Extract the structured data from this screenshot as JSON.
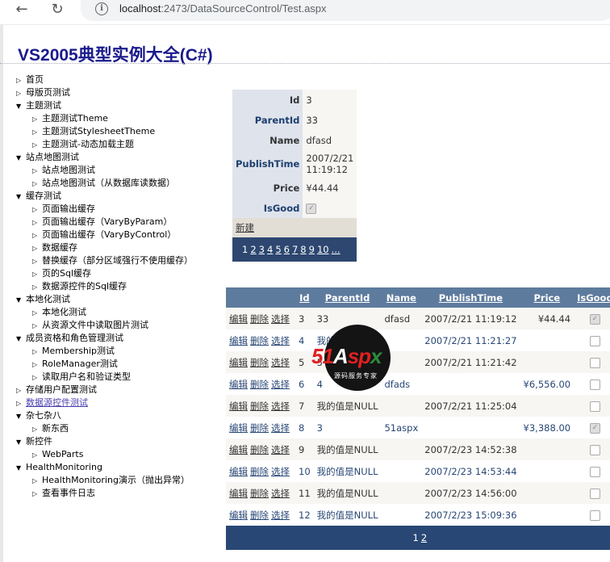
{
  "browser": {
    "url_host": "localhost",
    "url_rest": ":2473/DataSourceControl/Test.aspx"
  },
  "page": {
    "title": "VS2005典型实例大全(C#)"
  },
  "tree": {
    "nodes": [
      {
        "label": "首页",
        "level": 0,
        "state": "collapsed"
      },
      {
        "label": "母版页测试",
        "level": 0,
        "state": "collapsed"
      },
      {
        "label": "主题测试",
        "level": 0,
        "state": "expanded"
      },
      {
        "label": "主题测试Theme",
        "level": 1,
        "state": "collapsed"
      },
      {
        "label": "主题测试StylesheetTheme",
        "level": 1,
        "state": "collapsed"
      },
      {
        "label": "主题测试-动态加载主题",
        "level": 1,
        "state": "collapsed"
      },
      {
        "label": "站点地图测试",
        "level": 0,
        "state": "expanded"
      },
      {
        "label": "站点地图测试",
        "level": 1,
        "state": "collapsed"
      },
      {
        "label": "站点地图测试（从数据库读数据）",
        "level": 1,
        "state": "collapsed"
      },
      {
        "label": "缓存测试",
        "level": 0,
        "state": "expanded"
      },
      {
        "label": "页面输出缓存",
        "level": 1,
        "state": "collapsed"
      },
      {
        "label": "页面输出缓存（VaryByParam）",
        "level": 1,
        "state": "collapsed"
      },
      {
        "label": "页面输出缓存（VaryByControl）",
        "level": 1,
        "state": "collapsed"
      },
      {
        "label": "数据缓存",
        "level": 1,
        "state": "collapsed"
      },
      {
        "label": "替换缓存（部分区域强行不使用缓存）",
        "level": 1,
        "state": "collapsed"
      },
      {
        "label": "页的Sql缓存",
        "level": 1,
        "state": "collapsed"
      },
      {
        "label": "数据源控件的Sql缓存",
        "level": 1,
        "state": "collapsed"
      },
      {
        "label": "本地化测试",
        "level": 0,
        "state": "expanded"
      },
      {
        "label": "本地化测试",
        "level": 1,
        "state": "collapsed"
      },
      {
        "label": "从资源文件中读取图片测试",
        "level": 1,
        "state": "collapsed"
      },
      {
        "label": "成员资格和角色管理测试",
        "level": 0,
        "state": "expanded"
      },
      {
        "label": "Membership测试",
        "level": 1,
        "state": "collapsed"
      },
      {
        "label": "RoleManager测试",
        "level": 1,
        "state": "collapsed"
      },
      {
        "label": "读取用户名和验证类型",
        "level": 1,
        "state": "collapsed"
      },
      {
        "label": "存储用户配置测试",
        "level": 0,
        "state": "collapsed"
      },
      {
        "label": "数据源控件测试",
        "level": 0,
        "state": "selected"
      },
      {
        "label": "杂七杂八",
        "level": 0,
        "state": "expanded"
      },
      {
        "label": "新东西",
        "level": 1,
        "state": "collapsed"
      },
      {
        "label": "新控件",
        "level": 0,
        "state": "expanded"
      },
      {
        "label": "WebParts",
        "level": 1,
        "state": "collapsed"
      },
      {
        "label": "HealthMonitoring",
        "level": 0,
        "state": "expanded"
      },
      {
        "label": "HealthMonitoring演示（抛出异常）",
        "level": 1,
        "state": "collapsed"
      },
      {
        "label": "查看事件日志",
        "level": 1,
        "state": "collapsed"
      }
    ]
  },
  "details": {
    "rows": [
      {
        "key": "Id",
        "value": "3"
      },
      {
        "key": "ParentId",
        "value": "33"
      },
      {
        "key": "Name",
        "value": "dfasd"
      },
      {
        "key": "PublishTime",
        "value": "2007/2/21 11:19:12"
      },
      {
        "key": "Price",
        "value": "¥44.44"
      },
      {
        "key": "IsGood",
        "value": "",
        "checked": true
      }
    ],
    "new_link": "新建",
    "pager": {
      "current": "1",
      "pages": [
        "2",
        "3",
        "4",
        "5",
        "6",
        "7",
        "8",
        "9",
        "10",
        "..."
      ]
    }
  },
  "grid": {
    "headers": [
      "",
      "Id",
      "ParentId",
      "Name",
      "PublishTime",
      "Price",
      "IsGood"
    ],
    "actions": [
      "编辑",
      "删除",
      "选择"
    ],
    "rows": [
      {
        "id": "3",
        "parent": "33",
        "name": "dfasd",
        "time": "2007/2/21 11:19:12",
        "price": "¥44.44",
        "good": true
      },
      {
        "id": "4",
        "parent": "我的值是NULL",
        "name": "",
        "time": "2007/2/21 11:21:27",
        "price": "",
        "good": false
      },
      {
        "id": "5",
        "parent": "5",
        "name": "",
        "time": "2007/2/21 11:21:42",
        "price": "",
        "good": false
      },
      {
        "id": "6",
        "parent": "4",
        "name": "dfads",
        "time": "",
        "price": "¥6,556.00",
        "good": false
      },
      {
        "id": "7",
        "parent": "我的值是NULL",
        "name": "",
        "time": "2007/2/21 11:25:04",
        "price": "",
        "good": false
      },
      {
        "id": "8",
        "parent": "3",
        "name": "51aspx",
        "time": "",
        "price": "¥3,388.00",
        "good": true
      },
      {
        "id": "9",
        "parent": "我的值是NULL",
        "name": "",
        "time": "2007/2/23 14:52:38",
        "price": "",
        "good": false
      },
      {
        "id": "10",
        "parent": "我的值是NULL",
        "name": "",
        "time": "2007/2/23 14:53:44",
        "price": "",
        "good": false
      },
      {
        "id": "11",
        "parent": "我的值是NULL",
        "name": "",
        "time": "2007/2/23 14:56:00",
        "price": "",
        "good": false
      },
      {
        "id": "12",
        "parent": "我的值是NULL",
        "name": "",
        "time": "2007/2/23 15:09:36",
        "price": "",
        "good": false
      }
    ],
    "pager": {
      "current": "1",
      "pages": [
        "2"
      ]
    }
  },
  "watermark": {
    "text_a": "51",
    "text_b": "A",
    "text_c": "sp",
    "text_d": "x",
    "sub": "源码服务专家"
  }
}
